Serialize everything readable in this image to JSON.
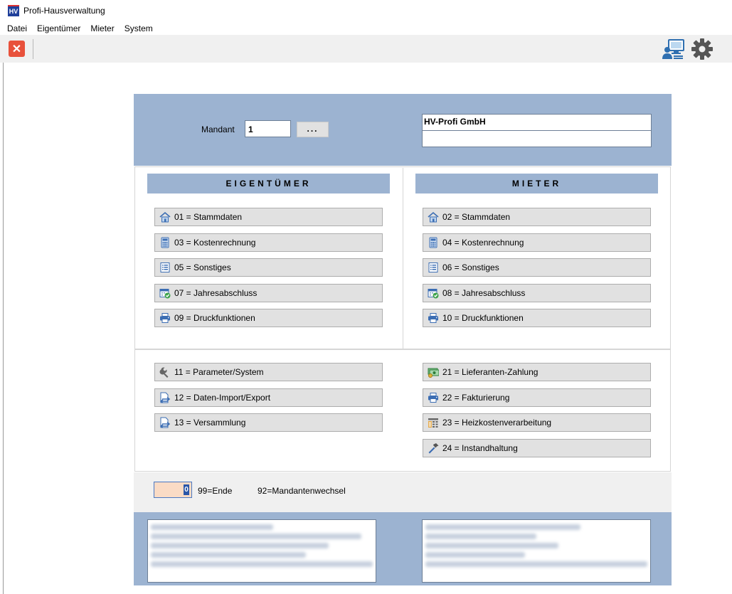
{
  "window": {
    "title": "Profi-Hausverwaltung",
    "icon_text": "HV"
  },
  "menubar": [
    "Datei",
    "Eigentümer",
    "Mieter",
    "System"
  ],
  "toolbar": {
    "close_symbol": "✕"
  },
  "header": {
    "mandant_label": "Mandant",
    "mandant_value": "1",
    "lookup_button": "...",
    "firm_name": "HV-Profi GmbH",
    "firm_line2": ""
  },
  "eigentuemer": {
    "heading": "EIGENTÜMER",
    "items": [
      {
        "label": "01 = Stammdaten",
        "icon": "house-icon"
      },
      {
        "label": "03 = Kostenrechnung",
        "icon": "calculator-icon"
      },
      {
        "label": "05 = Sonstiges",
        "icon": "list-icon"
      },
      {
        "label": "07 = Jahresabschluss",
        "icon": "calendar-check-icon"
      },
      {
        "label": "09 = Druckfunktionen",
        "icon": "printer-icon"
      }
    ]
  },
  "mieter": {
    "heading": "MIETER",
    "items": [
      {
        "label": "02 = Stammdaten",
        "icon": "house-icon"
      },
      {
        "label": "04 = Kostenrechnung",
        "icon": "calculator-icon"
      },
      {
        "label": "06 = Sonstiges",
        "icon": "list-icon"
      },
      {
        "label": "08 = Jahresabschluss",
        "icon": "calendar-check-icon"
      },
      {
        "label": "10 = Druckfunktionen",
        "icon": "printer-icon"
      }
    ]
  },
  "general_left": [
    {
      "label": "11 = Parameter/System",
      "icon": "wrench-icon"
    },
    {
      "label": "12 = Daten-Import/Export",
      "icon": "file-transfer-icon"
    },
    {
      "label": "13 = Versammlung",
      "icon": "file-transfer-icon"
    }
  ],
  "general_right": [
    {
      "label": "21 = Lieferanten-Zahlung",
      "icon": "money-icon"
    },
    {
      "label": "22 = Fakturierung",
      "icon": "printer-icon"
    },
    {
      "label": "23 = Heizkostenverarbeitung",
      "icon": "heating-table-icon"
    },
    {
      "label": "24 = Instandhaltung",
      "icon": "hammer-icon"
    }
  ],
  "footer": {
    "choice_value": "0",
    "hint_end": "99=Ende",
    "hint_switch": "92=Mandantenwechsel"
  }
}
